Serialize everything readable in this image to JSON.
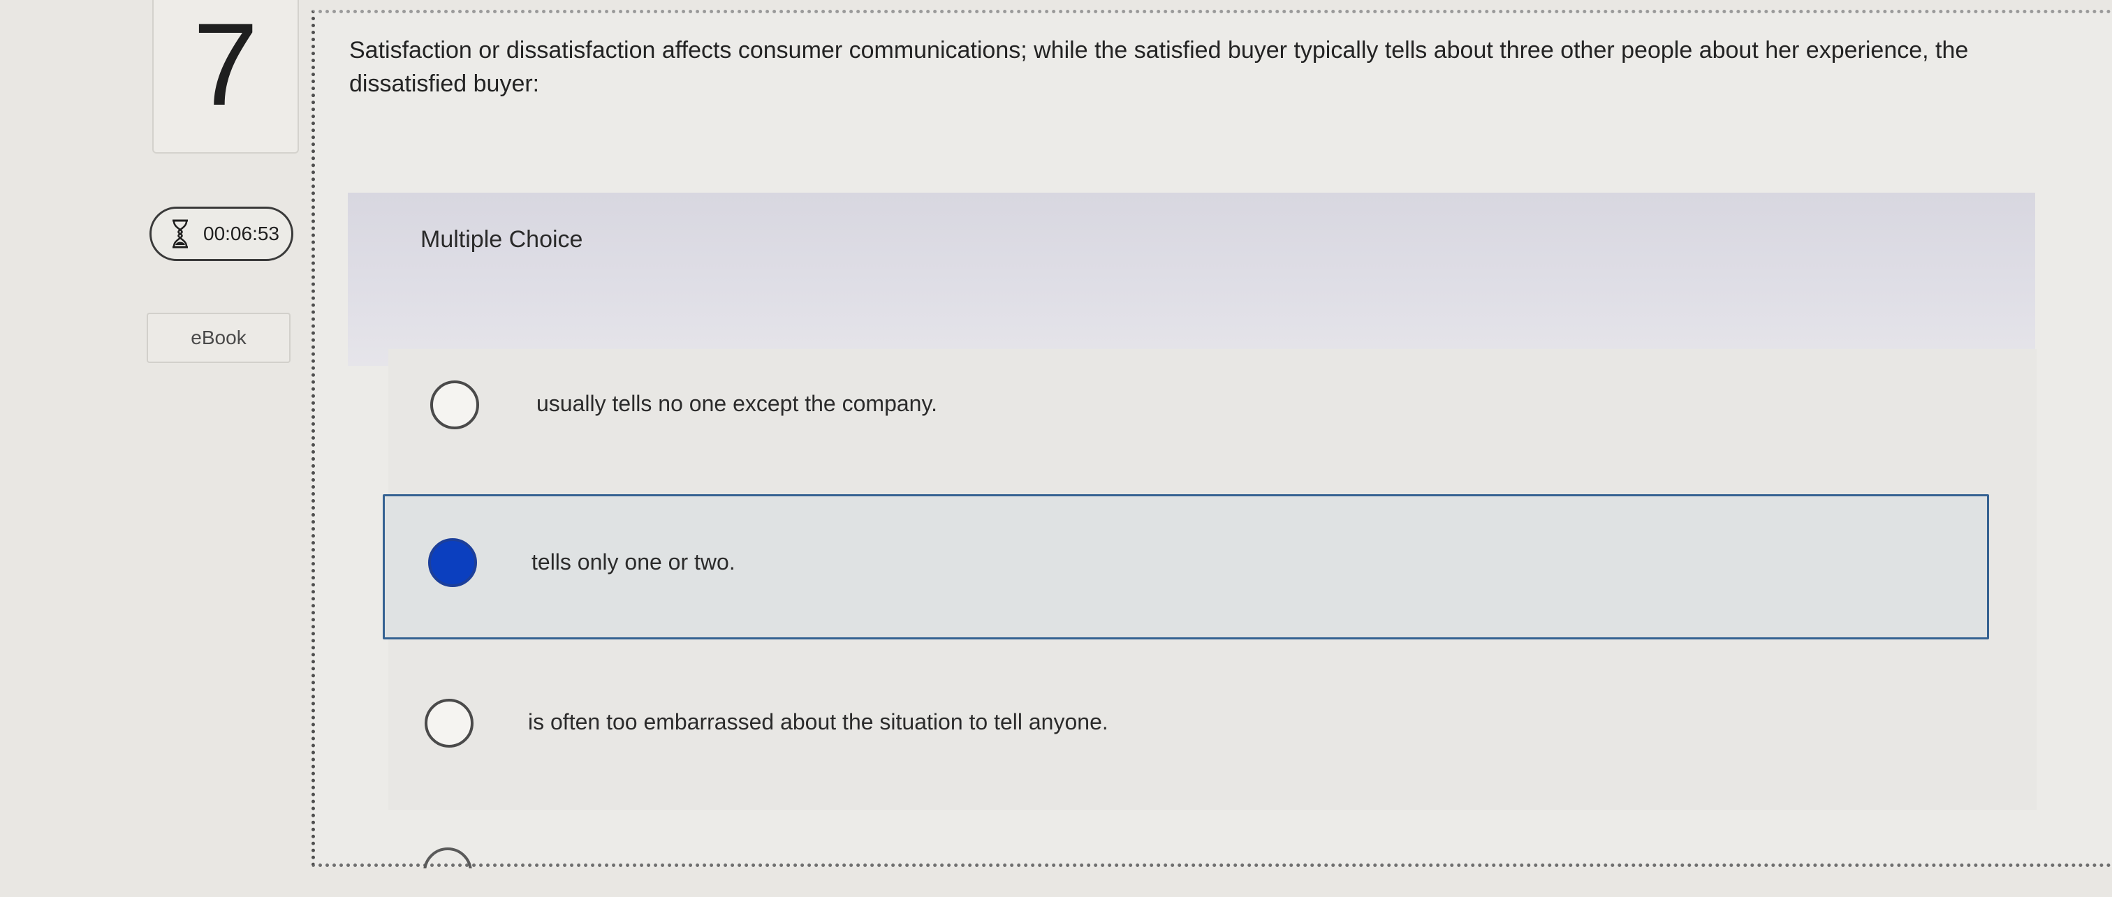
{
  "question": {
    "number": "7",
    "text": "Satisfaction or dissatisfaction affects consumer communications; while the satisfied buyer typically tells about three other people about her experience, the dissatisfied buyer:"
  },
  "timer": {
    "icon": "hourglass-icon",
    "value": "00:06:53"
  },
  "ebook": {
    "label": "eBook"
  },
  "choice": {
    "type_label": "Multiple Choice",
    "options": [
      {
        "label": "usually tells no one except the company.",
        "selected": false
      },
      {
        "label": "tells only one or two.",
        "selected": true
      },
      {
        "label": "is often too embarrassed about the situation to tell anyone.",
        "selected": false
      }
    ]
  },
  "colors": {
    "selected_radio": "#0b3fbf",
    "selected_border": "#356292"
  }
}
